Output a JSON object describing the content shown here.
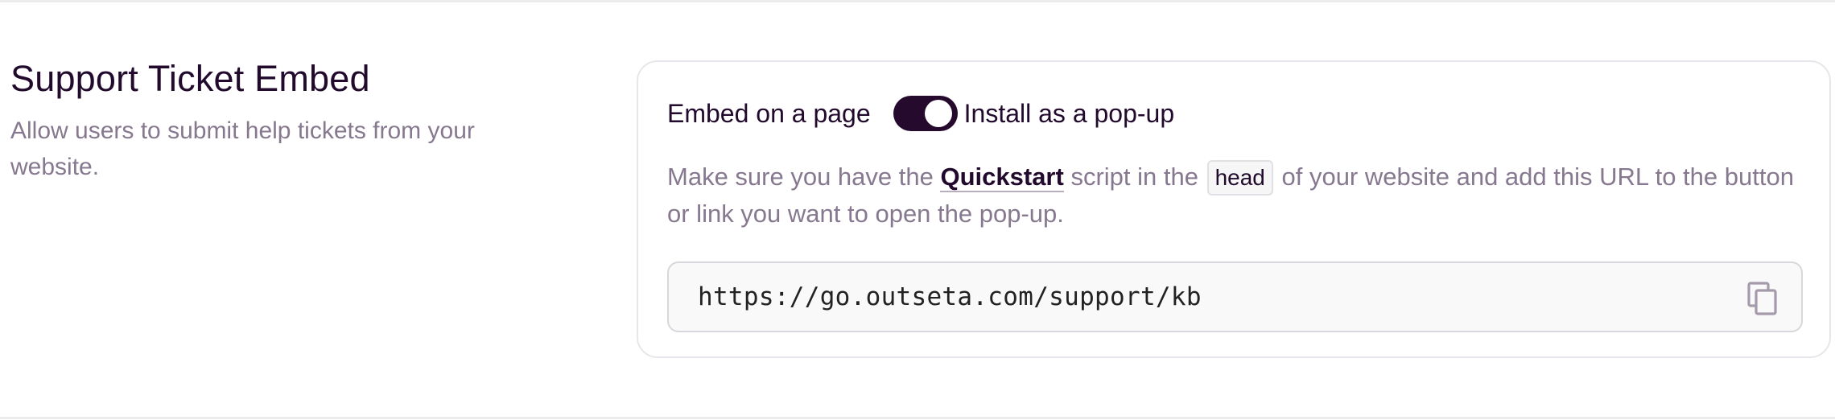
{
  "section": {
    "title": "Support Ticket Embed",
    "description": "Allow users to submit help tickets from your website."
  },
  "embed_mode": {
    "left_label": "Embed on a page",
    "right_label": "Install as a pop-up",
    "toggle_on": true,
    "toggle_color": "#250a2e"
  },
  "instructions": {
    "before_link": "Make sure you have the ",
    "link_text": "Quickstart",
    "middle": " script in the ",
    "code": "head",
    "after": " of your website and add this URL to the button or link you want to open the pop-up."
  },
  "url_field": {
    "value": "https://go.outseta.com/support/kb",
    "copy_icon": "copy-icon"
  }
}
